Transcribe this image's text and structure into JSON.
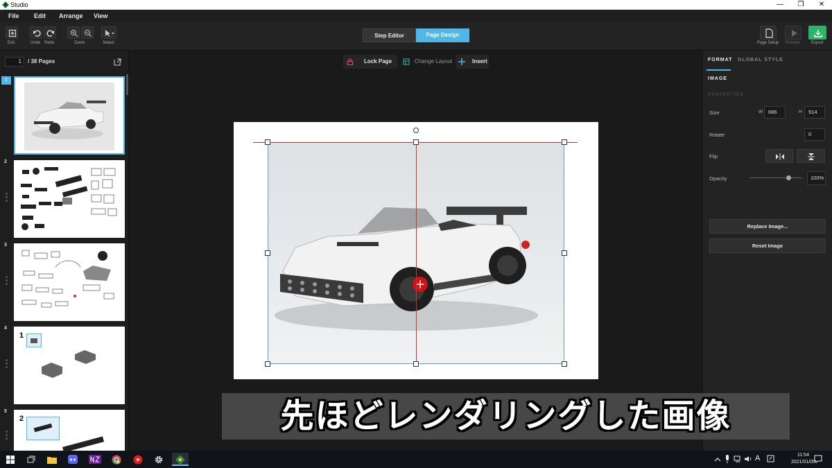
{
  "window": {
    "title": "Studio",
    "minimize": "—",
    "restore": "❐",
    "close": "✕"
  },
  "menu": {
    "items": [
      "File",
      "Edit",
      "Arrange",
      "View"
    ]
  },
  "toolbar": {
    "exit_label": "Exit",
    "undo_label": "Undo",
    "redo_label": "Redo",
    "zoom_label": "Zoom",
    "select_label": "Select",
    "mode_step_editor": "Step Editor",
    "mode_page_design": "Page Design",
    "page_setup_label": "Page Setup",
    "preview_label": "Preview",
    "export_label": "Export",
    "accent": "#4fb8e6",
    "export_color": "#2fb36b"
  },
  "pages_panel": {
    "current_page": "1",
    "total_label": "/ 38 Pages",
    "thumbnails": [
      {
        "number": "1"
      },
      {
        "number": "2"
      },
      {
        "number": "3"
      },
      {
        "number": "4",
        "step": "1"
      },
      {
        "number": "5",
        "step": "2"
      }
    ]
  },
  "canvas_tools": {
    "lock_page": "Lock Page",
    "change_layout": "Change Layout",
    "insert": "Insert"
  },
  "format_panel": {
    "tab_format": "FORMAT",
    "tab_global_style": "GLOBAL STYLE",
    "section": "IMAGE",
    "properties": "PROPERTIES",
    "size_label": "Size",
    "w_label": "W",
    "w_value": "686",
    "h_label": "H",
    "h_value": "514",
    "rotate_label": "Rotate",
    "rotate_value": "0",
    "flip_label": "Flip",
    "opacity_label": "Opacity",
    "opacity_value": "100%",
    "opacity_fraction": 0.75,
    "replace_image": "Replace Image...",
    "reset_image": "Reset Image"
  },
  "subtitle": {
    "text": "先ほどレンダリングした画像"
  },
  "taskbar": {
    "time": "11:54",
    "date": "2021/01/05",
    "ime": "A"
  }
}
